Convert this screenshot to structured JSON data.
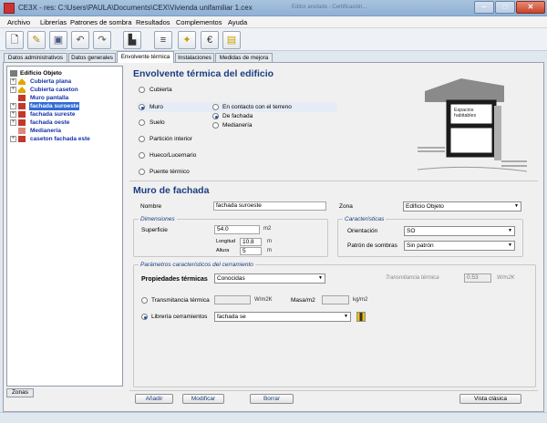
{
  "window": {
    "title": "CE3X - res: C:\\Users\\PAULA\\Documents\\CEX\\Vivienda unifamiliar 1.cex",
    "background_titles": [
      "Editor anotado - Certificación..."
    ]
  },
  "menu": [
    "Archivo",
    "Librerías",
    "Patrones de sombra",
    "Resultados",
    "Complementos",
    "Ayuda"
  ],
  "toolbar": [
    "new-icon",
    "open-icon",
    "save-icon",
    "undo-icon",
    "redo-icon",
    "building-icon",
    "layers-icon",
    "wand-icon",
    "euro-icon",
    "report-icon"
  ],
  "tabs": [
    {
      "label": "Datos administrativos",
      "active": false
    },
    {
      "label": "Datos generales",
      "active": false
    },
    {
      "label": "Envolvente térmica",
      "active": true
    },
    {
      "label": "Instalaciones",
      "active": false
    },
    {
      "label": "Medidas de mejora",
      "active": false
    }
  ],
  "tree": [
    {
      "label": "Edificio Objeto",
      "root": true,
      "icon": "building-icon"
    },
    {
      "label": "Cubierta plana",
      "icon": "roof-icon",
      "color": "#e3a400"
    },
    {
      "label": "Cubierta caseton",
      "icon": "roof-icon",
      "color": "#e3a400"
    },
    {
      "label": "Muro pantalla",
      "icon": "wall-icon",
      "color": "#c0392b"
    },
    {
      "label": "fachada suroeste",
      "icon": "wall-icon",
      "color": "#c0392b",
      "selected": true
    },
    {
      "label": "fachada sureste",
      "icon": "wall-icon",
      "color": "#c0392b"
    },
    {
      "label": "fachada oeste",
      "icon": "wall-icon",
      "color": "#c0392b"
    },
    {
      "label": "Medianería",
      "icon": "party-wall-icon",
      "color": "#d98c7a"
    },
    {
      "label": "caseton fachada este",
      "icon": "wall-icon",
      "color": "#c0392b"
    }
  ],
  "zonas_button": "Zonas",
  "envolvente": {
    "title": "Envolvente térmica del edificio",
    "types": [
      {
        "label": "Cubierta",
        "selected": false
      },
      {
        "label": "Muro",
        "selected": true
      },
      {
        "label": "Suelo",
        "selected": false
      },
      {
        "label": "Partición interior",
        "selected": false
      },
      {
        "label": "Hueco/Lucernario",
        "selected": false
      },
      {
        "label": "Puente térmico",
        "selected": false
      }
    ],
    "subtypes": [
      {
        "label": "En contacto con el terreno",
        "selected": false
      },
      {
        "label": "De fachada",
        "selected": true
      },
      {
        "label": "Medianería",
        "selected": false
      }
    ],
    "diagram_label": "Espacios habitables"
  },
  "muro": {
    "title": "Muro de fachada",
    "nombre_label": "Nombre",
    "nombre_value": "fachada suroeste",
    "zona_label": "Zona",
    "zona_value": "Edificio Objeto",
    "dimensiones": {
      "title": "Dimensiones",
      "superficie_label": "Superficie",
      "superficie_value": "54.0",
      "superficie_unit": "m2",
      "longitud_label": "Longitud",
      "longitud_value": "10.8",
      "longitud_unit": "m",
      "altura_label": "Altura",
      "altura_value": "5",
      "altura_unit": "m"
    },
    "caracteristicas": {
      "title": "Características",
      "orientacion_label": "Orientación",
      "orientacion_value": "SO",
      "patron_label": "Patrón de sombras",
      "patron_value": "Sin patrón"
    },
    "parametros": {
      "title": "Parámetros característicos del cerramiento",
      "propiedades_label": "Propiedades térmicas",
      "propiedades_value": "Conocidas",
      "transmitancia_label": "Transmitancia térmica",
      "transmitancia_value": "0.53",
      "transmitancia_unit": "W/m2K",
      "opt1_label": "Transmitancia térmica",
      "opt1_unit": "W/m2K",
      "masa_label": "Masa/m2",
      "masa_unit": "kg/m2",
      "opt2_label": "Librería cerramientos",
      "libreria_value": "fachada se",
      "opt2_selected": true
    }
  },
  "actions": {
    "anadir": "Añadir",
    "modificar": "Modificar",
    "borrar": "Borrar",
    "vista_clasica": "Vista clásica"
  }
}
